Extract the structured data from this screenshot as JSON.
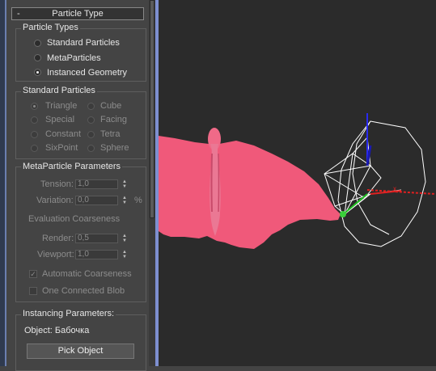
{
  "rollout": {
    "collapse_symbol": "-",
    "title": "Particle Type"
  },
  "particle_types": {
    "title": "Particle Types",
    "options": [
      "Standard Particles",
      "MetaParticles",
      "Instanced Geometry"
    ],
    "selected": "Instanced Geometry"
  },
  "standard_particles": {
    "title": "Standard Particles",
    "options": [
      "Triangle",
      "Cube",
      "Special",
      "Facing",
      "Constant",
      "Tetra",
      "SixPoint",
      "Sphere"
    ],
    "selected": "Triangle"
  },
  "metaparticle_parameters": {
    "title": "MetaParticle Parameters",
    "tension": {
      "label": "Tension:",
      "value": "1,0"
    },
    "variation": {
      "label": "Variation:",
      "value": "0,0",
      "unit": "%"
    },
    "evaluation_coarseness": "Evaluation Coarseness",
    "render": {
      "label": "Render:",
      "value": "0,5"
    },
    "viewport": {
      "label": "Viewport:",
      "value": "1,0"
    },
    "automatic_coarseness": {
      "label": "Automatic Coarseness",
      "checked": true
    },
    "one_connected_blob": {
      "label": "One Connected Blob",
      "checked": false
    }
  },
  "instancing_parameters": {
    "title": "Instancing Parameters:",
    "object_label": "Object: Бабочка",
    "pick_button": "Pick Object"
  },
  "colors": {
    "butterfly": "#f0597a",
    "gizmo_blue": "#2a2af0",
    "gizmo_red": "#e02020",
    "gizmo_green": "#20c020",
    "wire": "#ffffff"
  }
}
